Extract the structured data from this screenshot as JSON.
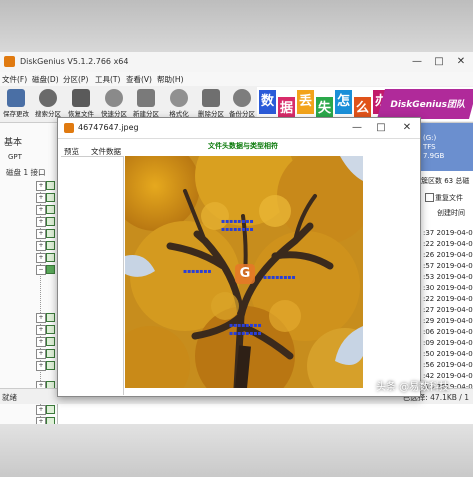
{
  "app": {
    "title": "DiskGenius V5.1.2.766 x64",
    "menu": [
      "文件(F)",
      "磁盘(D)",
      "分区(P)",
      "工具(T)",
      "查看(V)",
      "帮助(H)"
    ],
    "toolbar": [
      "保存更改",
      "搜索分区",
      "恢复文件",
      "快速分区",
      "新建分区",
      "格式化",
      "删除分区",
      "备份分区"
    ],
    "banner": {
      "chars": [
        "数",
        "据",
        "丢",
        "失",
        "怎",
        "么",
        "办"
      ],
      "brand": "DiskGenius团队",
      "chip": "QQ: 4"
    }
  },
  "left_panel": {
    "label_basic": "基本",
    "label_gpt": "GPT",
    "label_disk": "磁盘 1 接口"
  },
  "right_panel": {
    "disk_label": "(G:)",
    "fs": "TFS",
    "size": "7.9GB",
    "header_partial": "簇区数 63 总磁",
    "checkbox": "重复文件",
    "col_created": "创建时间",
    "dates": [
      ":37  2019-04-0",
      ":22  2019-04-0",
      ":26  2019-04-0",
      ":57  2019-04-0",
      ":53  2019-04-0",
      ":30  2019-04-0",
      ":22  2019-04-0",
      ":27  2019-04-0",
      ":29  2019-04-0",
      ":06  2019-04-0",
      ":09  2019-04-0",
      ":50  2019-04-0",
      ":56  2019-04-0",
      ":42  2019-04-0",
      ":15  2019-04-0"
    ]
  },
  "dialog": {
    "title": "46747647.jpeg",
    "tab_preview": "预览",
    "tab_data": "文件数据",
    "header": "文件头数据与类型相符"
  },
  "status": {
    "left": "就绪",
    "right": "已选择: 47.1KB / 1"
  },
  "watermark": "头条 @易数科技",
  "colors": {
    "accent": "#e07a10",
    "banner_brand": "#b02a9a",
    "dialog_header": "#0a7a0a",
    "overlay_text": "#2a3fd8"
  }
}
